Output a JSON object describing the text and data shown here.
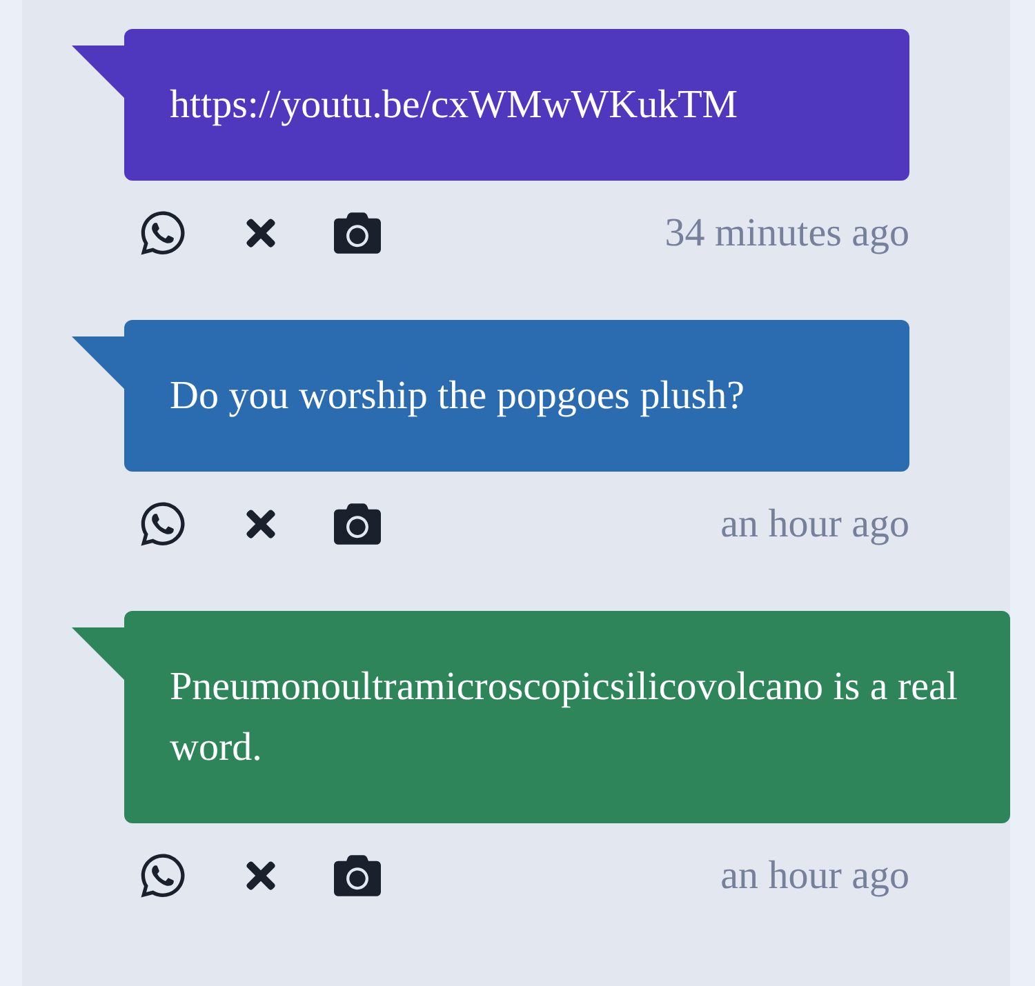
{
  "messages": [
    {
      "text": "https://youtu.be/cxWMwWKukTM",
      "color": "#4f38bd",
      "time": "34 minutes ago"
    },
    {
      "text": "Do you worship the popgoes plush?",
      "color": "#2b6cb0",
      "time": "an hour ago"
    },
    {
      "text": "Pneumonoultramicroscopicsilicovolcano is a real word.",
      "color": "#2f855a",
      "time": "an hour ago"
    }
  ]
}
